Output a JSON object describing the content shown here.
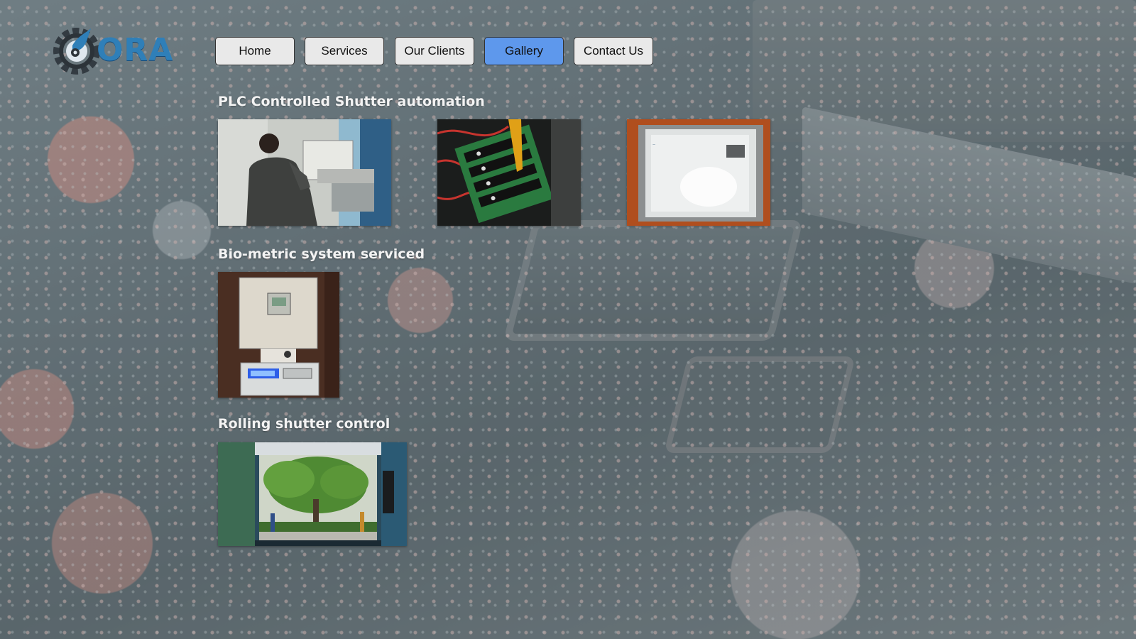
{
  "brand": {
    "logo_text": "ORA"
  },
  "nav": {
    "items": [
      {
        "label": "Home",
        "active": false
      },
      {
        "label": "Services",
        "active": false
      },
      {
        "label": "Our Clients",
        "active": false
      },
      {
        "label": "Gallery",
        "active": true
      },
      {
        "label": "Contact Us",
        "active": false
      }
    ]
  },
  "gallery": {
    "sections": [
      {
        "title": "PLC Controlled Shutter automation"
      },
      {
        "title": "Bio-metric system serviced"
      },
      {
        "title": "Rolling shutter control"
      }
    ]
  },
  "colors": {
    "nav_active": "#5e98ec",
    "nav_default": "#e9e9e9",
    "logo_blue": "#2f7fb8",
    "heading_text": "#f3f3f3"
  }
}
